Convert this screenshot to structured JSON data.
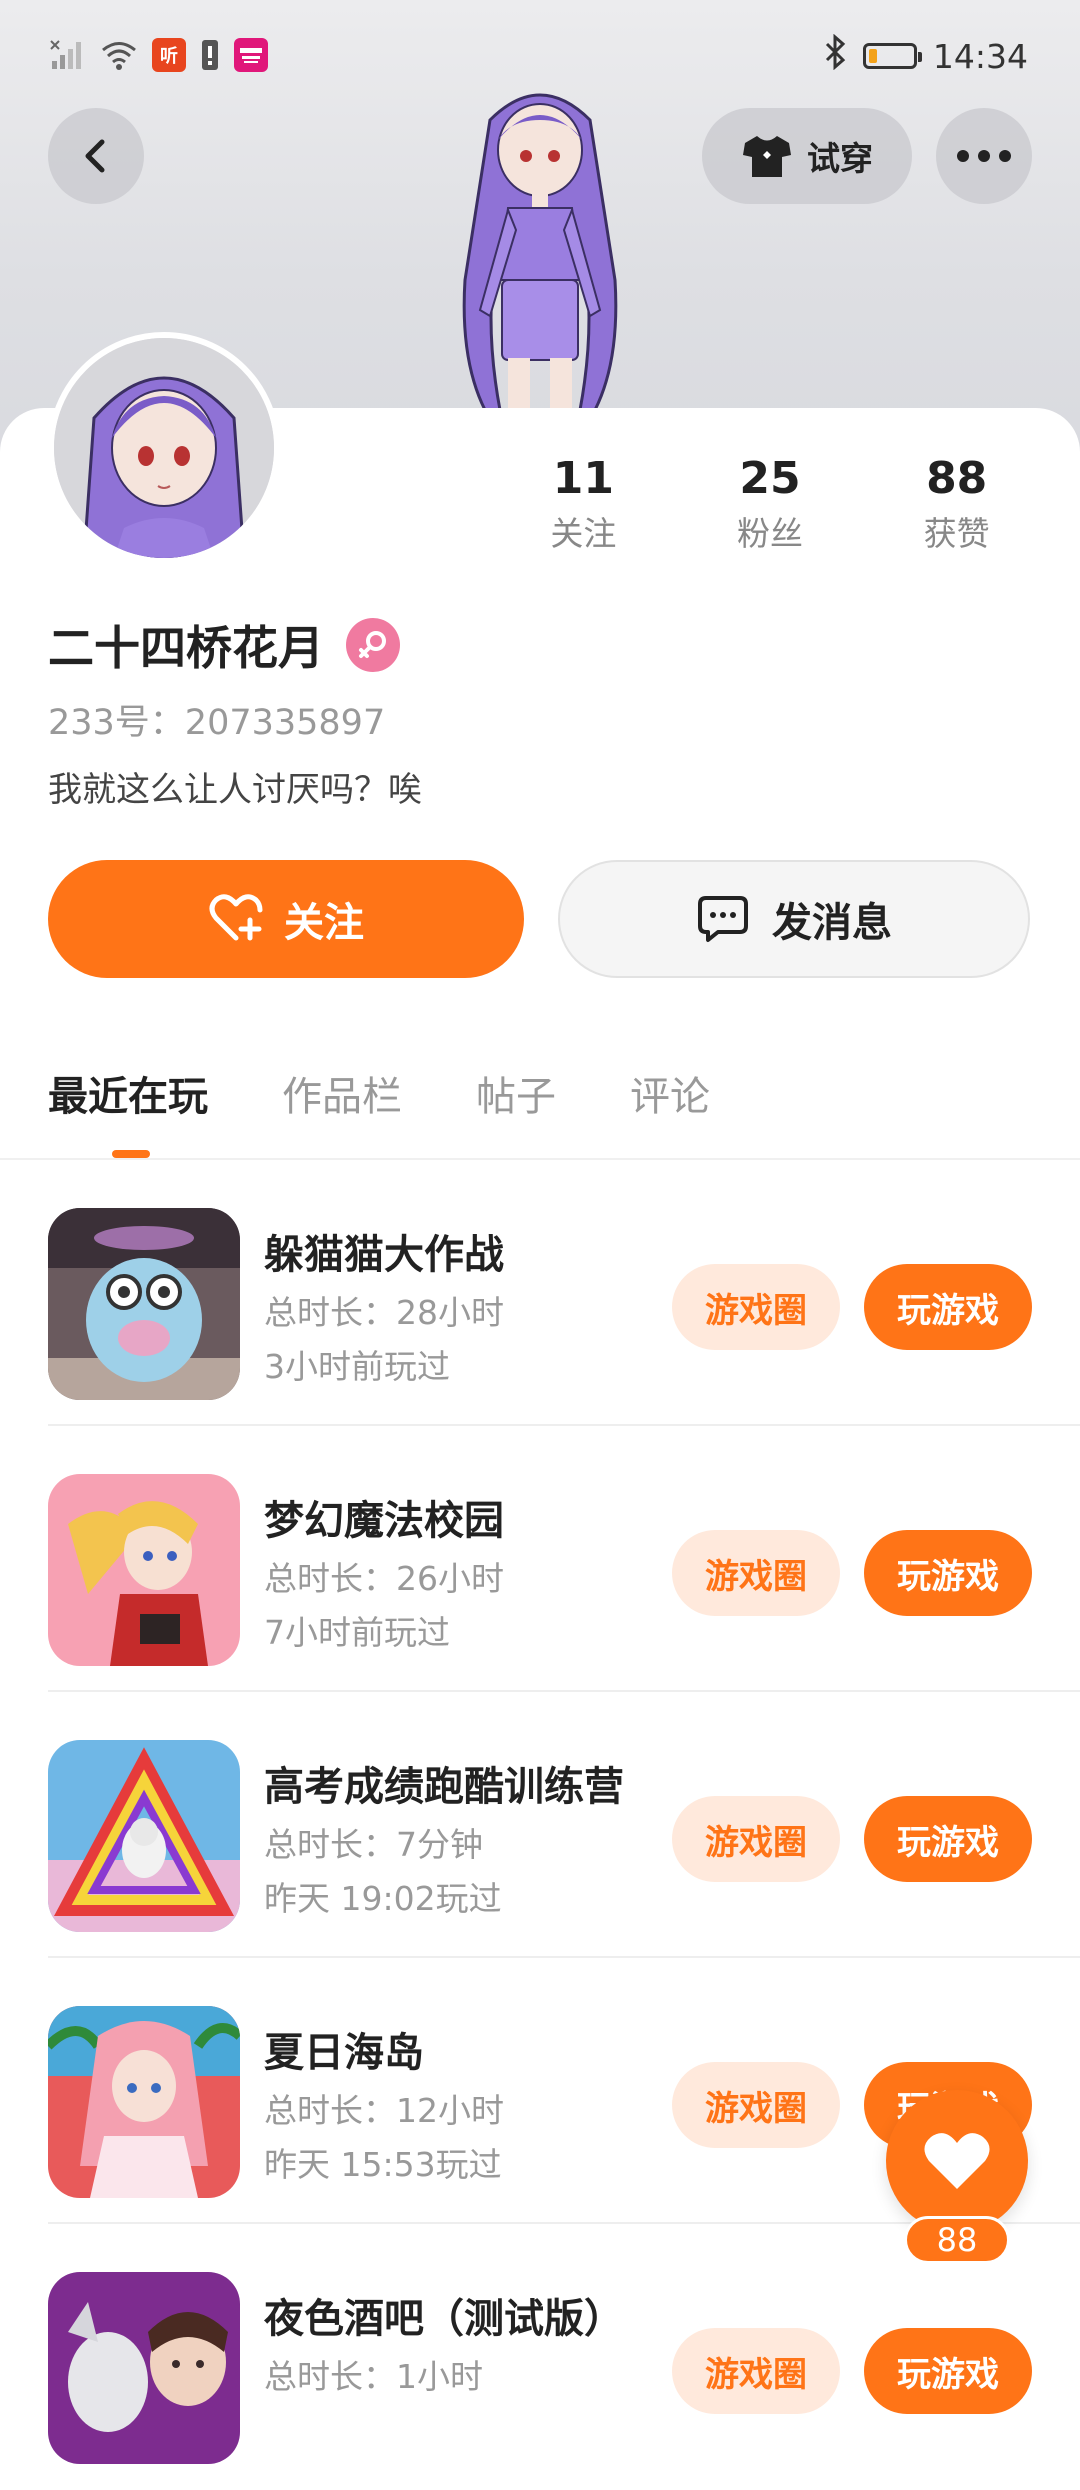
{
  "status_bar": {
    "time": "14:34",
    "left_icons": [
      "signal-icon",
      "wifi-icon",
      "listen-app-icon",
      "sim-alert-icon",
      "mall-app-icon"
    ],
    "listen_badge": "听",
    "battery_level": 0.2,
    "battery_color": "#f3a21a"
  },
  "header": {
    "try_on_label": "试穿"
  },
  "profile": {
    "stats": [
      {
        "value": "11",
        "label": "关注"
      },
      {
        "value": "25",
        "label": "粉丝"
      },
      {
        "value": "88",
        "label": "获赞"
      }
    ],
    "nickname": "二十四桥花月",
    "gender": "female",
    "uid": "233号：207335897",
    "bio": "我就这么让人讨厌吗？唉"
  },
  "actions": {
    "follow_label": "关注",
    "message_label": "发消息"
  },
  "tabs": [
    {
      "label": "最近在玩",
      "active": true
    },
    {
      "label": "作品栏",
      "active": false
    },
    {
      "label": "帖子",
      "active": false
    },
    {
      "label": "评论",
      "active": false
    }
  ],
  "games": [
    {
      "title": "躲猫猫大作战",
      "duration": "总时长：28小时",
      "last_played": "3小时前玩过",
      "circle_label": "游戏圈",
      "play_label": "玩游戏"
    },
    {
      "title": "梦幻魔法校园",
      "duration": "总时长：26小时",
      "last_played": "7小时前玩过",
      "circle_label": "游戏圈",
      "play_label": "玩游戏"
    },
    {
      "title": "高考成绩跑酷训练营",
      "duration": "总时长：7分钟",
      "last_played": "昨天 19:02玩过",
      "circle_label": "游戏圈",
      "play_label": "玩游戏"
    },
    {
      "title": "夏日海岛",
      "duration": "总时长：12小时",
      "last_played": "昨天 15:53玩过",
      "circle_label": "游戏圈",
      "play_label": "玩游戏"
    },
    {
      "title": "夜色酒吧（测试版）",
      "duration": "总时长：1小时",
      "last_played": "",
      "circle_label": "游戏圈",
      "play_label": "玩游戏"
    }
  ],
  "like_fab": {
    "count": "88"
  },
  "colors": {
    "accent": "#ff7417",
    "accent_light": "#ffe9dc",
    "gender_badge": "#f07aa0"
  }
}
